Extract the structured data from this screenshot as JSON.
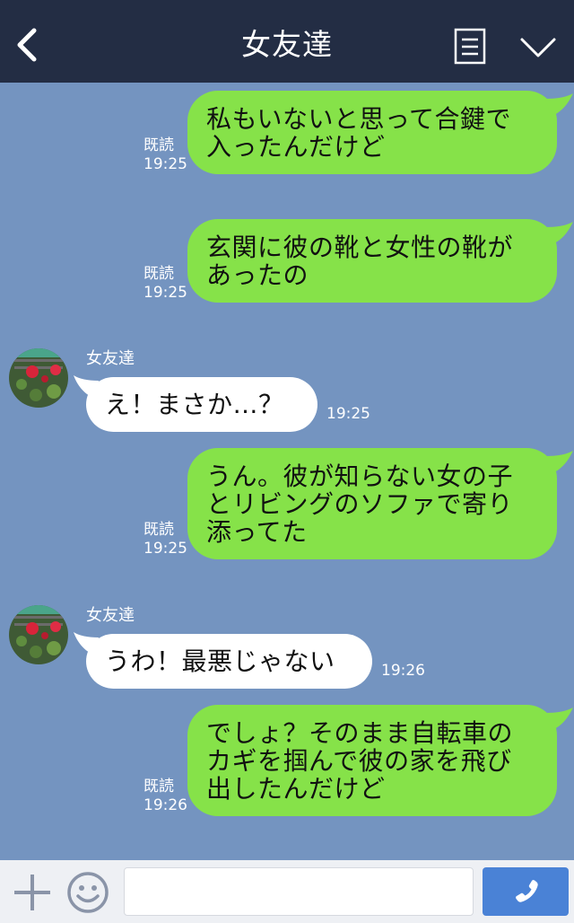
{
  "header": {
    "title": "女友達",
    "back_icon": "chevron-left-icon",
    "menu_icon": "notes-icon",
    "collapse_icon": "chevron-down-icon"
  },
  "messages": [
    {
      "from": "me",
      "lines": [
        "私もいないと思って合鍵で",
        "入ったんだけど"
      ],
      "read": "既読",
      "time": "19:25"
    },
    {
      "from": "me",
      "lines": [
        "玄関に彼の靴と女性の靴が",
        "あったの"
      ],
      "read": "既読",
      "time": "19:25"
    },
    {
      "from": "friend",
      "sender": "女友達",
      "lines": [
        "え！まさか…？"
      ],
      "time": "19:25"
    },
    {
      "from": "me",
      "lines": [
        "うん。彼が知らない女の子",
        "とリビングのソファで寄り",
        "添ってた"
      ],
      "read": "既読",
      "time": "19:25"
    },
    {
      "from": "friend",
      "sender": "女友達",
      "lines": [
        "うわ！最悪じゃない"
      ],
      "time": "19:26"
    },
    {
      "from": "me",
      "lines": [
        "でしょ？そのまま自転車の",
        "カギを掴んで彼の家を飛び",
        "出したんだけど"
      ],
      "read": "既読",
      "time": "19:26"
    }
  ],
  "footer": {
    "plus_icon": "plus-icon",
    "emoji_icon": "smiley-icon",
    "input_value": "",
    "call_icon": "phone-icon"
  },
  "colors": {
    "header_bg": "#232d44",
    "chat_bg": "#7494c0",
    "my_bubble": "#86e249",
    "friend_bubble": "#ffffff",
    "call_button": "#4a82d6"
  }
}
